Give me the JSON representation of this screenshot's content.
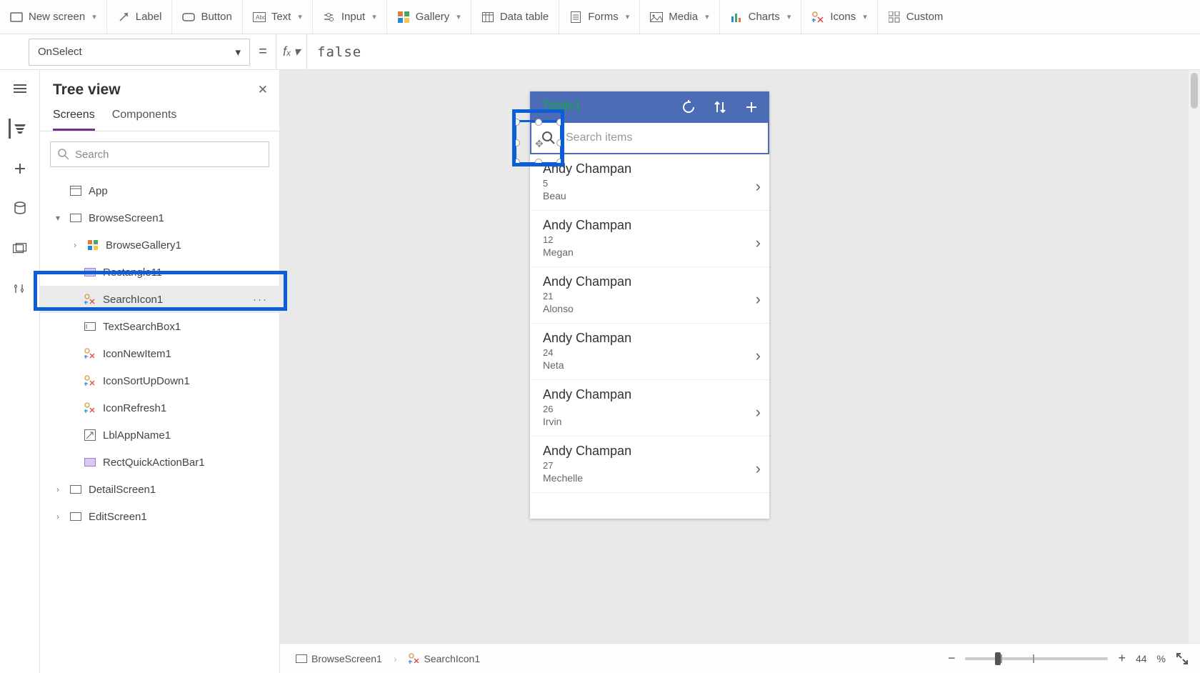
{
  "toolbar": {
    "new_screen": "New screen",
    "label": "Label",
    "button": "Button",
    "text": "Text",
    "input": "Input",
    "gallery": "Gallery",
    "data_table": "Data table",
    "forms": "Forms",
    "media": "Media",
    "charts": "Charts",
    "icons": "Icons",
    "custom": "Custom"
  },
  "formula": {
    "property": "OnSelect",
    "value": "false"
  },
  "tree": {
    "title": "Tree view",
    "tabs": {
      "screens": "Screens",
      "components": "Components"
    },
    "search_placeholder": "Search",
    "items": {
      "app": "App",
      "browse_screen": "BrowseScreen1",
      "browse_gallery": "BrowseGallery1",
      "rectangle11": "Rectangle11",
      "search_icon": "SearchIcon1",
      "text_search_box": "TextSearchBox1",
      "icon_new_item": "IconNewItem1",
      "icon_sort": "IconSortUpDown1",
      "icon_refresh": "IconRefresh1",
      "lbl_app_name": "LblAppName1",
      "rect_quick_action": "RectQuickActionBar1",
      "detail_screen": "DetailScreen1",
      "edit_screen": "EditScreen1"
    }
  },
  "canvas": {
    "app_title": "Table1",
    "search_placeholder": "Search items",
    "gallery_items": [
      {
        "name": "Andy Champan",
        "num": "5",
        "sub": "Beau"
      },
      {
        "name": "Andy Champan",
        "num": "12",
        "sub": "Megan"
      },
      {
        "name": "Andy Champan",
        "num": "21",
        "sub": "Alonso"
      },
      {
        "name": "Andy Champan",
        "num": "24",
        "sub": "Neta"
      },
      {
        "name": "Andy Champan",
        "num": "26",
        "sub": "Irvin"
      },
      {
        "name": "Andy Champan",
        "num": "27",
        "sub": "Mechelle"
      }
    ]
  },
  "status": {
    "crumb1": "BrowseScreen1",
    "crumb2": "SearchIcon1",
    "zoom": "44",
    "zoom_unit": "%"
  }
}
